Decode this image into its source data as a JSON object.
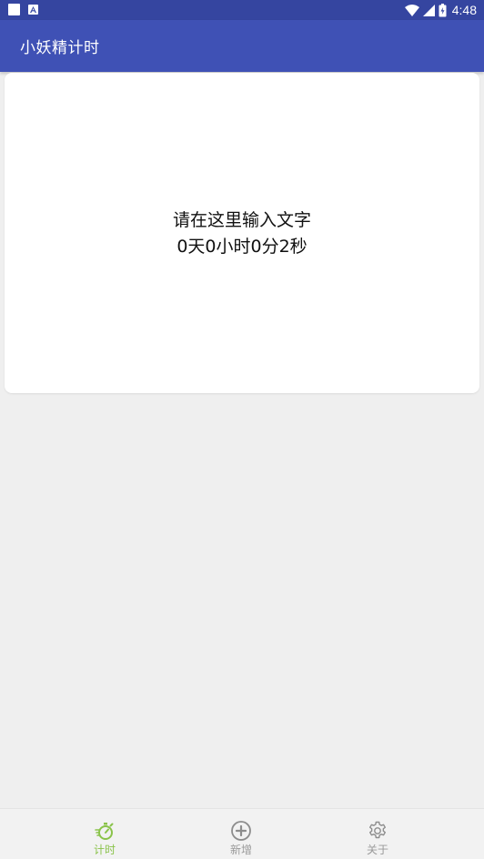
{
  "status_bar": {
    "time": "4:48",
    "icons": [
      "notification-square-icon",
      "a-badge-icon",
      "wifi-icon",
      "signal-icon",
      "battery-icon"
    ]
  },
  "app_bar": {
    "title": "小妖精计时",
    "background_color": "#3f51b5"
  },
  "card": {
    "text_line1": "请在这里输入文字",
    "text_line2": "0天0小时0分2秒"
  },
  "bottom_nav": {
    "active_color": "#8ac34a",
    "inactive_color": "#9a9a9a",
    "items": [
      {
        "label": "计时",
        "icon": "stopwatch-icon",
        "active": true
      },
      {
        "label": "新增",
        "icon": "add-circle-icon",
        "active": false
      },
      {
        "label": "关于",
        "icon": "gear-icon",
        "active": false
      }
    ]
  }
}
